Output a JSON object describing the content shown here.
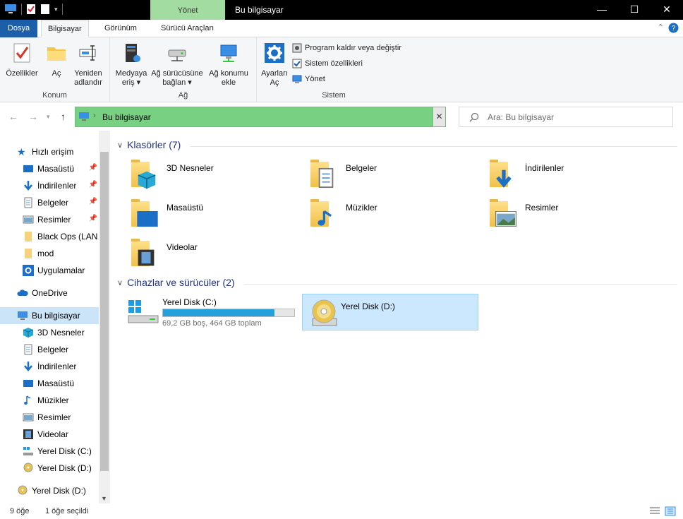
{
  "titlebar": {
    "title": "Bu bilgisayar",
    "context_tab": "Yönet"
  },
  "tabs": [
    "Dosya",
    "Bilgisayar",
    "Görünüm",
    "Sürücü Araçları"
  ],
  "ribbon": {
    "konum": {
      "label": "Konum",
      "buttons": [
        {
          "line1": "Özellikler",
          "line2": ""
        },
        {
          "line1": "Aç",
          "line2": ""
        },
        {
          "line1": "Yeniden",
          "line2": "adlandır"
        }
      ]
    },
    "ag": {
      "label": "Ağ",
      "buttons": [
        {
          "line1": "Medyaya",
          "line2": "eriş ▾"
        },
        {
          "line1": "Ağ sürücüsüne",
          "line2": "bağlan ▾"
        },
        {
          "line1": "Ağ konumu",
          "line2": "ekle"
        }
      ]
    },
    "sistem": {
      "label": "Sistem",
      "button": {
        "line1": "Ayarları",
        "line2": "Aç"
      },
      "small": [
        "Program kaldır veya değiştir",
        "Sistem özellikleri",
        "Yönet"
      ]
    }
  },
  "address": {
    "path": "Bu bilgisayar",
    "search_placeholder": "Ara: Bu bilgisayar"
  },
  "navpane": {
    "quick_access": "Hızlı erişim",
    "quick_items": [
      "Masaüstü",
      "İndirilenler",
      "Belgeler",
      "Resimler",
      "Black Ops (LAN",
      "mod",
      "Uygulamalar"
    ],
    "onedrive": "OneDrive",
    "this_pc": "Bu bilgisayar",
    "pc_items": [
      "3D Nesneler",
      "Belgeler",
      "İndirilenler",
      "Masaüstü",
      "Müzikler",
      "Resimler",
      "Videolar",
      "Yerel Disk (C:)",
      "Yerel Disk (D:)"
    ],
    "bottom_item": "Yerel Disk (D:)"
  },
  "content": {
    "folders_header": "Klasörler (7)",
    "folders": [
      "3D Nesneler",
      "Belgeler",
      "İndirilenler",
      "Masaüstü",
      "Müzikler",
      "Resimler",
      "Videolar"
    ],
    "devices_header": "Cihazlar ve sürücüler (2)",
    "drive_c": {
      "name": "Yerel Disk (C:)",
      "info": "69,2 GB boş, 464 GB toplam",
      "used_fraction": 0.85
    },
    "drive_d": {
      "name": "Yerel Disk (D:)"
    }
  },
  "status": {
    "count": "9 öğe",
    "selected": "1 öğe seçildi"
  },
  "colors": {
    "accent": "#1c5ea8",
    "address_bg": "#78d082",
    "selection": "#cce8ff",
    "header_text": "#1e3287"
  }
}
